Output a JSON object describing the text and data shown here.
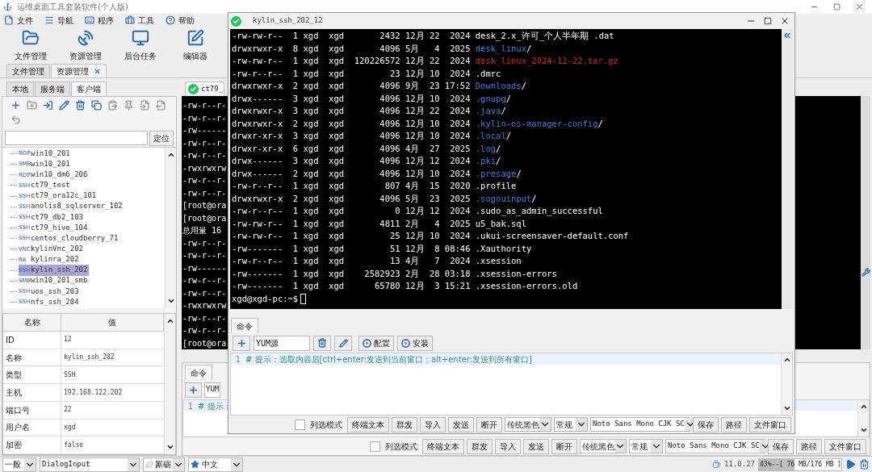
{
  "app_title": "运维桌面工具套装软件(个人版)",
  "menu": [
    "文件",
    "导航",
    "程序",
    "工具",
    "帮助"
  ],
  "toolbar": [
    "文件管理",
    "资源管理",
    "后台任务",
    "编辑器"
  ],
  "outer_tabs": [
    {
      "label": "文件管理",
      "selected": false,
      "closable": false
    },
    {
      "label": "资源管理",
      "selected": true,
      "closable": true
    }
  ],
  "left_panel": {
    "tabs": [
      {
        "label": "本地",
        "selected": false
      },
      {
        "label": "服务端",
        "selected": false
      },
      {
        "label": "客户端",
        "selected": true
      }
    ],
    "locate_button": "定位",
    "tree": [
      {
        "type": "RDP",
        "name": "win10_201",
        "selected": false
      },
      {
        "type": "SMB",
        "name": "win10_201",
        "selected": false
      },
      {
        "type": "RDP",
        "name": "win10_dm6_206",
        "selected": false
      },
      {
        "type": "SSH",
        "name": "ct79_test",
        "selected": false
      },
      {
        "type": "SSH",
        "name": "ct79_ora12c_101",
        "selected": false
      },
      {
        "type": "SSH",
        "name": "anolis8_sqlserver_102",
        "selected": false
      },
      {
        "type": "SSH",
        "name": "ct79_db2_103",
        "selected": false
      },
      {
        "type": "SSH",
        "name": "ct79_hive_104",
        "selected": false
      },
      {
        "type": "SSH",
        "name": "centos_cloudberry_71",
        "selected": false
      },
      {
        "type": "VNC",
        "name": "kylinVnc_202",
        "selected": false
      },
      {
        "type": "RA",
        "name": "kylinra_202",
        "selected": false
      },
      {
        "type": "SSH",
        "name": "kylin_ssh_202",
        "selected": true
      },
      {
        "type": "SMB",
        "name": "win10_201_smb",
        "selected": false
      },
      {
        "type": "SSH",
        "name": "uos_ssh_203",
        "selected": false
      },
      {
        "type": "SSH",
        "name": "nfs_ssh_204",
        "selected": false
      }
    ],
    "properties": {
      "columns": [
        "名称",
        "值"
      ],
      "rows": [
        {
          "name": "ID",
          "value": "12"
        },
        {
          "name": "名称",
          "value": "kylin_ssh_202"
        },
        {
          "name": "类型",
          "value": "SSH"
        },
        {
          "name": "主机",
          "value": "192.168.122.202"
        },
        {
          "name": "端口号",
          "value": "22"
        },
        {
          "name": "用户名",
          "value": "xgd"
        },
        {
          "name": "加密",
          "value": "false"
        }
      ]
    }
  },
  "main_tab": {
    "label": "ct79_",
    "connected": true
  },
  "background_terminal": {
    "lines": [
      "-rw-r--r-",
      "-rw-r--r-",
      "-rw------",
      "-rw-r--r-",
      "-rw-r--r-",
      "-rwxrwxrw",
      "-rw-r--r-",
      "-rw-r--r-",
      "[root@ora",
      "[root@ora",
      "总用量 16",
      "-rw-r--r-",
      "-rw-r--r-",
      "-rw------",
      "-rw-r--r-",
      "-rw-r--r-",
      "-rwxrwxrw",
      "-rw-r--r-",
      "-rw-r--r-",
      "[root@ora"
    ]
  },
  "background_command": {
    "tab": "命令",
    "preset": "YUM",
    "line_number": "1",
    "text": "# 提示：",
    "bar": {
      "column_mode": {
        "label": "列选模式",
        "checked": false
      },
      "buttons": [
        "终端文本",
        "群发",
        "导入",
        "发送",
        "断开"
      ],
      "selects": [
        "传统黑色",
        "常规",
        "Noto Sans Mono CJK SC"
      ],
      "end_buttons": [
        "保存",
        "路径",
        "文件窗口"
      ]
    }
  },
  "floating_window": {
    "title": "kylin_ssh_202_12",
    "connected": true,
    "terminal": {
      "lines": [
        {
          "prefix": "-rw-rw-r--  1 xgd  xgd       2432 12月 22  2024",
          "name": "desk_2.x_许可_个人半年期 .dat",
          "kind": "file"
        },
        {
          "prefix": "drwxrwxr-x  8 xgd  xgd       4096 5月   4  2025",
          "name": "desk_linux",
          "kind": "dir"
        },
        {
          "prefix": "-rw-rw-r--  1 xgd  xgd  120226572 12月 22  2024",
          "name": "desk_linux_2024-12-22.tar.gz",
          "kind": "archive"
        },
        {
          "prefix": "-rw-r--r--  1 xgd  xgd         23 12月 10  2024",
          "name": ".dmrc",
          "kind": "file"
        },
        {
          "prefix": "drwxrwxr-x  2 xgd  xgd       4096 9月  23 17:52",
          "name": "Downloads",
          "kind": "dir"
        },
        {
          "prefix": "drwx------  3 xgd  xgd       4096 12月 10  2024",
          "name": ".gnupg",
          "kind": "dir"
        },
        {
          "prefix": "drwxrwxr-x  3 xgd  xgd       4096 12月 22  2024",
          "name": ".java",
          "kind": "dir"
        },
        {
          "prefix": "drwxrwxr-x  2 xgd  xgd       4096 12月 10  2024",
          "name": ".kylin-os-manager-config",
          "kind": "dir"
        },
        {
          "prefix": "drwxr-xr-x  3 xgd  xgd       4096 12月 10  2024",
          "name": ".local",
          "kind": "dir"
        },
        {
          "prefix": "drwxr-xr-x  6 xgd  xgd       4096 4月  27  2025",
          "name": ".log",
          "kind": "dir"
        },
        {
          "prefix": "drwx------  3 xgd  xgd       4096 12月 12  2024",
          "name": ".pki",
          "kind": "dir"
        },
        {
          "prefix": "drwx------  2 xgd  xgd       4096 12月 10  2024",
          "name": ".presage",
          "kind": "dir"
        },
        {
          "prefix": "-rw-r--r--  1 xgd  xgd        807 4月  15  2020",
          "name": ".profile",
          "kind": "file"
        },
        {
          "prefix": "drwxrwxr-x  2 xgd  xgd       4096 5月  23  2025",
          "name": ".sogouinput",
          "kind": "dir"
        },
        {
          "prefix": "-rw-r--r--  1 xgd  xgd          0 12月 12  2024",
          "name": ".sudo_as_admin_successful",
          "kind": "file"
        },
        {
          "prefix": "-rw-rw-r--  1 xgd  xgd       4811 2月   4  2025",
          "name": "u5_bak.sql",
          "kind": "file"
        },
        {
          "prefix": "-rw-rw-r--  1 xgd  xgd         25 12月 10  2024",
          "name": ".ukui-screensaver-default.conf",
          "kind": "file"
        },
        {
          "prefix": "-rw-------  1 xgd  xgd         51 12月  8 08:46",
          "name": ".Xauthority",
          "kind": "file"
        },
        {
          "prefix": "-rw-r--r--  1 xgd  xgd         13 4月   7  2024",
          "name": ".xsession",
          "kind": "file"
        },
        {
          "prefix": "-rw-------  1 xgd  xgd    2582923 2月  28 03:18",
          "name": ".xsession-errors",
          "kind": "file"
        },
        {
          "prefix": "-rw-------  1 xgd  xgd      65780 12月  3 15:21",
          "name": ".xsession-errors.old",
          "kind": "file"
        }
      ],
      "dir_suffix": "/",
      "prompt": "xgd@xgd-pc:~$"
    },
    "command": {
      "tab": "命令",
      "preset": "YUM源",
      "actions": [
        "配置",
        "安装"
      ],
      "line_number": "1",
      "text": "# 提示：选取内容后[ctrl+enter:发送到当前窗口；alt+enter:发送到所有窗口]",
      "bar": {
        "column_mode": {
          "label": "列选模式",
          "checked": false
        },
        "buttons": [
          "终端文本",
          "群发",
          "导入",
          "发送",
          "断开"
        ],
        "selects": [
          "传统黑色",
          "常规",
          "Noto Sans Mono CJK SC"
        ],
        "end_buttons": [
          "保存",
          "路径",
          "文件窗口"
        ]
      }
    }
  },
  "status_bar": {
    "level": "一般",
    "font": "DialogInput",
    "look": "厮砺",
    "language": "中文",
    "java_version": "11.0.27",
    "memory": {
      "text": "43%--[ 76 MB/176 MB ]",
      "level": 0.43
    }
  }
}
